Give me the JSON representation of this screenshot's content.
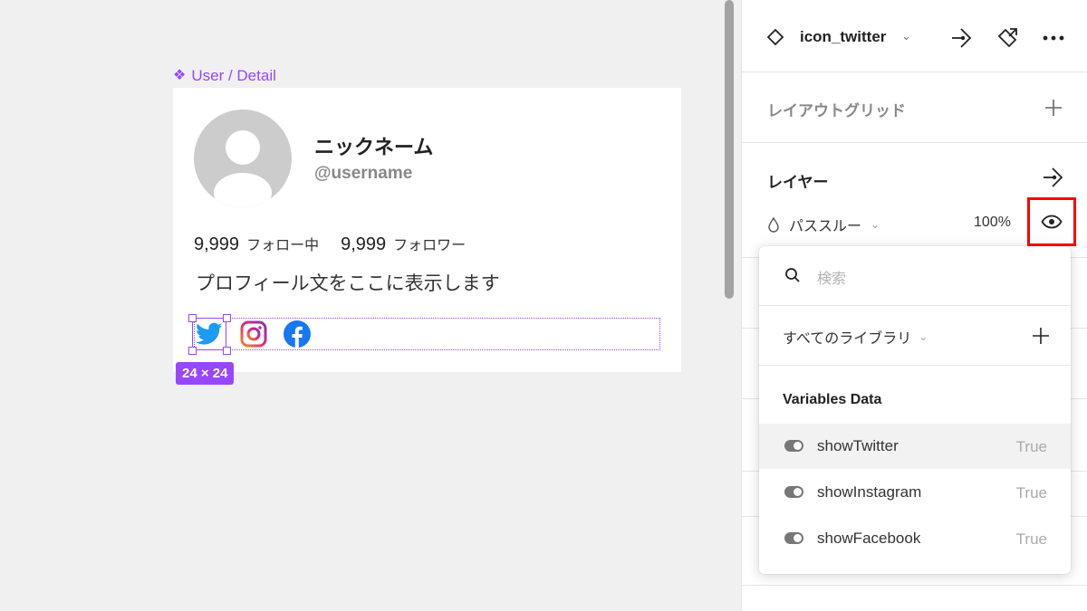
{
  "canvas": {
    "frame_label": "User / Detail",
    "profile": {
      "nickname": "ニックネーム",
      "username": "@username",
      "following_count": "9,999",
      "following_label": "フォロー中",
      "followers_count": "9,999",
      "followers_label": "フォロワー",
      "bio": "プロフィール文をここに表示します"
    },
    "social_icons": [
      "twitter-icon",
      "instagram-icon",
      "facebook-icon"
    ],
    "selection_size": "24 × 24"
  },
  "panel": {
    "component_name": "icon_twitter",
    "layout_grid_title": "レイアウトグリッド",
    "layer_title": "レイヤー",
    "blend_mode": "パススルー",
    "opacity": "100%"
  },
  "popover": {
    "search_placeholder": "検索",
    "library_selector": "すべてのライブラリ",
    "section_title": "Variables Data",
    "variables": [
      {
        "name": "showTwitter",
        "value": "True"
      },
      {
        "name": "showInstagram",
        "value": "True"
      },
      {
        "name": "showFacebook",
        "value": "True"
      }
    ]
  },
  "colors": {
    "accent_purple": "#9747ff",
    "highlight_red": "#ff0000",
    "twitter_blue": "#1d9bf0",
    "facebook_blue": "#1877f2"
  }
}
